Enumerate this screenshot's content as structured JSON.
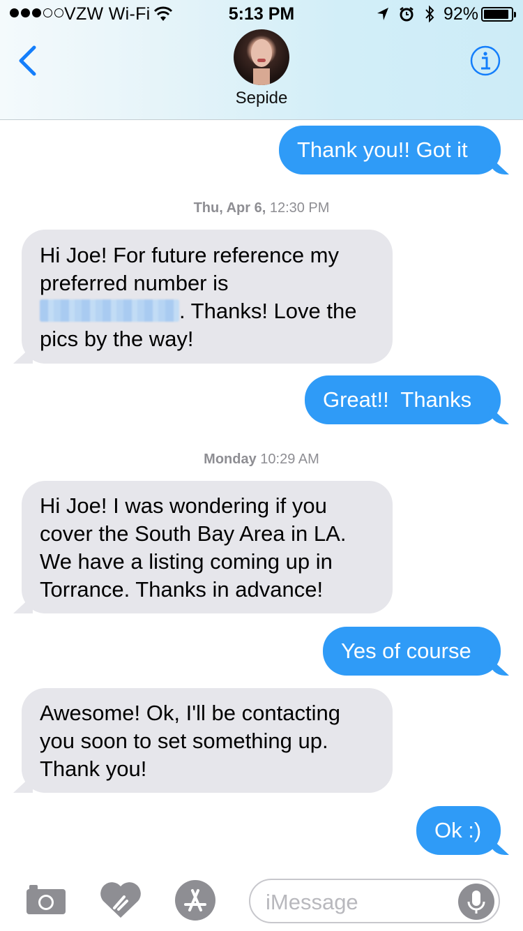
{
  "status_bar": {
    "carrier": "VZW Wi-Fi",
    "time": "5:13 PM",
    "battery_percent": "92%",
    "battery_level": 0.92,
    "icons": [
      "location-arrow-icon",
      "alarm-icon",
      "bluetooth-icon"
    ]
  },
  "header": {
    "contact_name": "Sepide",
    "back_icon": "chevron-left-icon",
    "info_icon": "info-icon",
    "accent_color": "#147efb"
  },
  "conversation": {
    "sent_color": "#2f9bf7",
    "received_color": "#e6e6eb",
    "m1": "Thank you!! Got it",
    "ts1": {
      "day": "Thu, Apr 6,",
      "time": "12:30 PM"
    },
    "m2": {
      "line1": "Hi Joe! For future reference my",
      "line2": "preferred number is",
      "line3_after": ". Thanks! Love the",
      "line4": "pics by the way!"
    },
    "m3": "Great!!  Thanks",
    "ts2": {
      "day": "Monday",
      "time": "10:29 AM"
    },
    "m4": {
      "line1": "Hi Joe! I was wondering if you",
      "line2": "cover the South Bay Area in LA.",
      "line3": "We have a listing coming up in",
      "line4": "Torrance. Thanks in advance!"
    },
    "m5": "Yes of course",
    "m6": {
      "line1": "Awesome! Ok, I'll be contacting",
      "line2": "you soon to set something up.",
      "line3": "Thank you!"
    },
    "m7": "Ok :)"
  },
  "input_bar": {
    "placeholder": "iMessage",
    "tools": [
      "camera-icon",
      "digital-touch-icon",
      "app-store-icon",
      "microphone-icon"
    ]
  }
}
